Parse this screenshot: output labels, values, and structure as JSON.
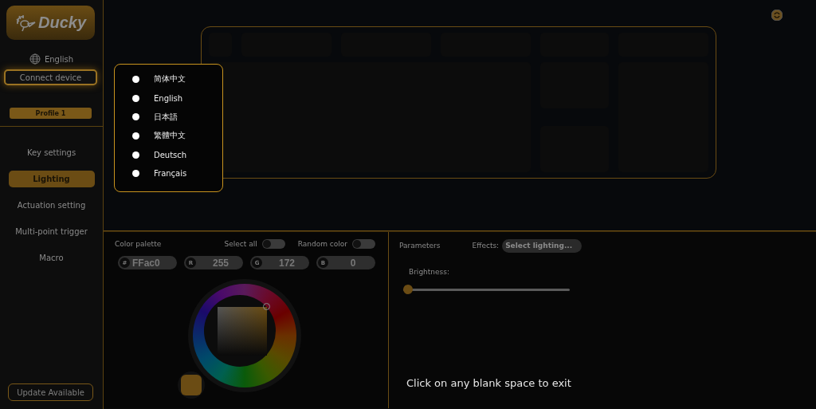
{
  "sidebar": {
    "logo_text": "Ducky",
    "language": "English",
    "connect_button": "Connect device",
    "profile": "Profile 1",
    "nav": [
      {
        "label": "Key settings",
        "selected": false
      },
      {
        "label": "Lighting",
        "selected": true
      },
      {
        "label": "Actuation setting",
        "selected": false
      },
      {
        "label": "Multi-point trigger",
        "selected": false
      },
      {
        "label": "Macro",
        "selected": false
      }
    ],
    "update_button": "Update Available"
  },
  "language_menu": {
    "items": [
      {
        "label": "简体中文"
      },
      {
        "label": "English"
      },
      {
        "label": "日本語"
      },
      {
        "label": "繁體中文"
      },
      {
        "label": "Deutsch"
      },
      {
        "label": "Français"
      }
    ]
  },
  "color_palette": {
    "title": "Color palette",
    "select_all": {
      "label": "Select all",
      "on": false
    },
    "random_color": {
      "label": "Random color",
      "on": false
    },
    "fields": [
      {
        "label": "#",
        "value": "FFac0"
      },
      {
        "label": "R",
        "value": "255"
      },
      {
        "label": "G",
        "value": "172"
      },
      {
        "label": "B",
        "value": "0"
      }
    ]
  },
  "parameters": {
    "title": "Parameters",
    "effects_label": "Effects:",
    "effects_select": "Select lighting...",
    "brightness_label": "Brightness:",
    "brightness": {
      "level": 0
    }
  },
  "hint": "Click on any blank space to exit"
}
